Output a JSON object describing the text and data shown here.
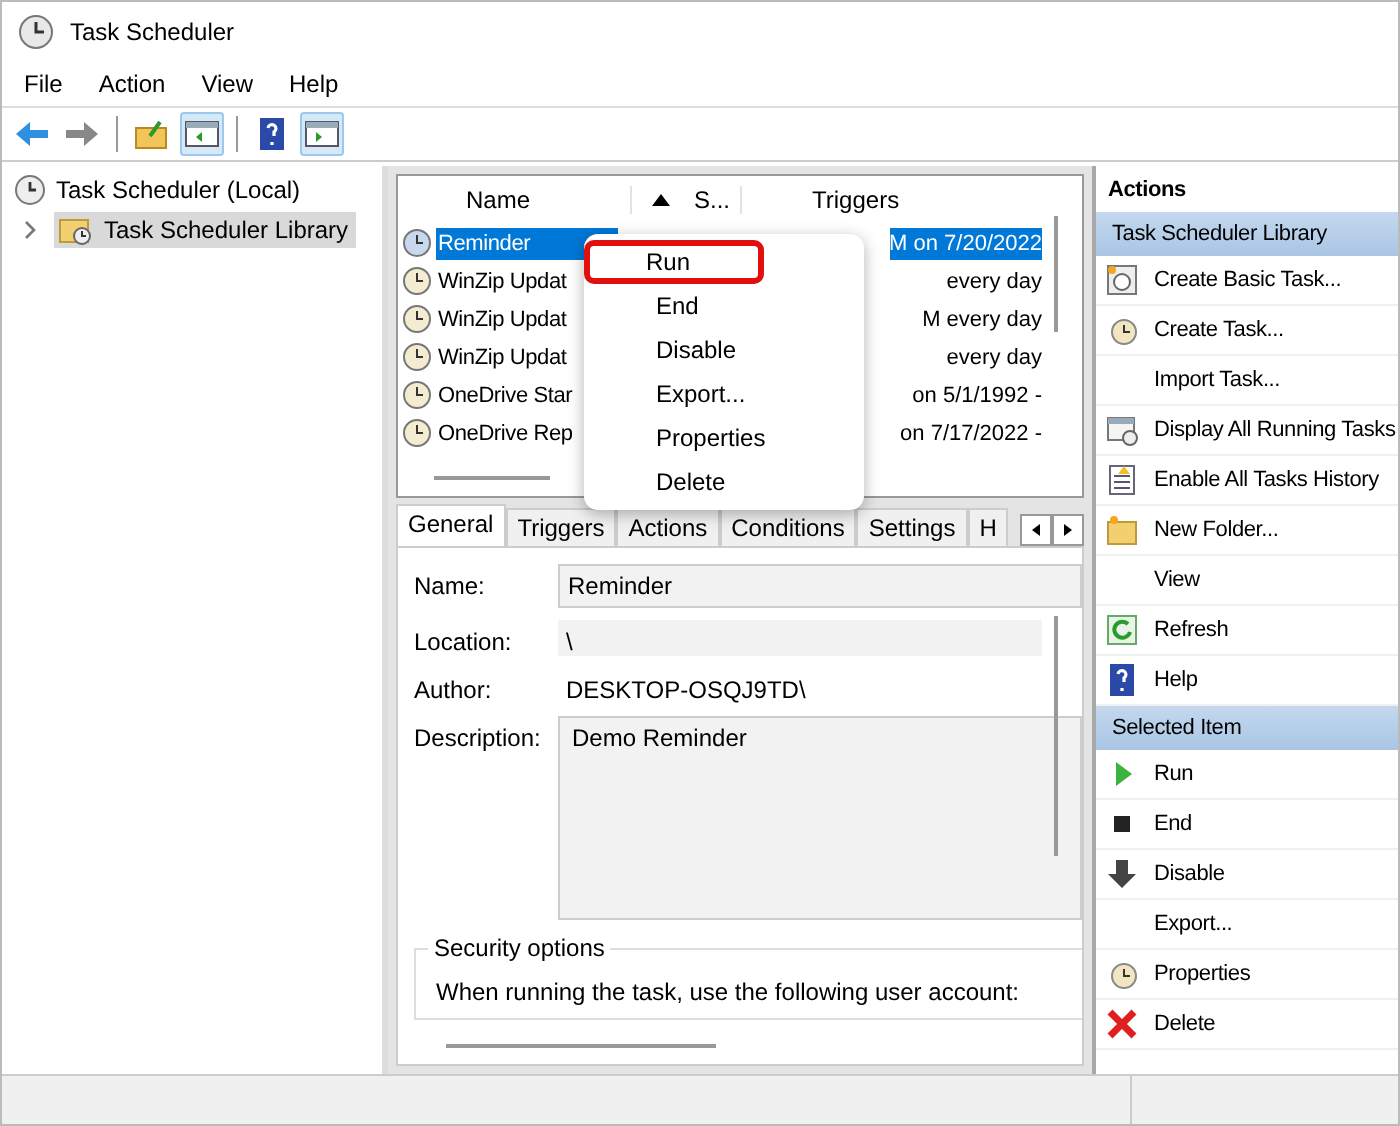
{
  "window": {
    "title": "Task Scheduler"
  },
  "menu": [
    "File",
    "Action",
    "View",
    "Help"
  ],
  "toolbar": [
    {
      "kind": "back",
      "pressed": false
    },
    {
      "kind": "forward",
      "pressed": false
    },
    {
      "kind": "up-folder",
      "pressed": false
    },
    {
      "kind": "pane-left",
      "pressed": true
    },
    {
      "kind": "help",
      "pressed": false
    },
    {
      "kind": "pane-right",
      "pressed": true
    }
  ],
  "tree": [
    {
      "label": "Task Scheduler (Local)",
      "selected": false,
      "children": [
        {
          "label": "Task Scheduler Library",
          "selected": true,
          "expanded": false
        }
      ]
    }
  ],
  "task_list": {
    "columns": [
      "Name",
      "S...",
      "Triggers"
    ],
    "rows": [
      {
        "name": "Reminder",
        "trigger": "M on 7/20/2022",
        "selected": true
      },
      {
        "name": "WinZip Updat",
        "trigger": "every day",
        "selected": false
      },
      {
        "name": "WinZip Updat",
        "trigger": "M every day",
        "selected": false
      },
      {
        "name": "WinZip Updat",
        "trigger": "every day",
        "selected": false
      },
      {
        "name": "OneDrive Star",
        "trigger": "on 5/1/1992 -",
        "selected": false
      },
      {
        "name": "OneDrive Rep",
        "trigger": "on 7/17/2022 -",
        "selected": false
      }
    ]
  },
  "context_menu": {
    "items": [
      {
        "label": "Run",
        "highlighted": true
      },
      {
        "label": "End",
        "highlighted": false
      },
      {
        "label": "Disable",
        "highlighted": false
      },
      {
        "label": "Export...",
        "highlighted": false
      },
      {
        "label": "Properties",
        "highlighted": false
      },
      {
        "label": "Delete",
        "highlighted": false
      }
    ]
  },
  "details": {
    "tabs": [
      {
        "label": "General",
        "selected": true
      },
      {
        "label": "Triggers",
        "selected": false
      },
      {
        "label": "Actions",
        "selected": false
      },
      {
        "label": "Conditions",
        "selected": false
      },
      {
        "label": "Settings",
        "selected": false
      },
      {
        "label": "H",
        "selected": false
      }
    ],
    "fields": [
      {
        "label": "Name:",
        "value": "Reminder",
        "kind": "box"
      },
      {
        "label": "Location:",
        "value": "\\",
        "kind": "plain"
      },
      {
        "label": "Author:",
        "value": "DESKTOP-OSQJ9TD\\",
        "kind": "plain"
      },
      {
        "label": "Description:",
        "value": "Demo Reminder",
        "kind": "area"
      }
    ],
    "security": {
      "title": "Security options",
      "text": "When running the task, use the following user account:"
    }
  },
  "actions": {
    "title": "Actions",
    "sections": [
      {
        "title": "Task Scheduler Library",
        "items": [
          {
            "label": "Create Basic Task...",
            "kind": "basic-task"
          },
          {
            "label": "Create Task...",
            "kind": "task"
          },
          {
            "label": "Import Task...",
            "kind": "plain"
          },
          {
            "label": "Display All Running Tasks",
            "kind": "running"
          },
          {
            "label": "Enable All Tasks History",
            "kind": "history"
          },
          {
            "label": "New Folder...",
            "kind": "folder"
          },
          {
            "label": "View",
            "kind": "plain"
          },
          {
            "label": "Refresh",
            "kind": "refresh"
          },
          {
            "label": "Help",
            "kind": "help"
          }
        ]
      },
      {
        "title": "Selected Item",
        "items": [
          {
            "label": "Run",
            "kind": "run"
          },
          {
            "label": "End",
            "kind": "end"
          },
          {
            "label": "Disable",
            "kind": "disable"
          },
          {
            "label": "Export...",
            "kind": "plain"
          },
          {
            "label": "Properties",
            "kind": "properties"
          },
          {
            "label": "Delete",
            "kind": "delete"
          }
        ]
      }
    ]
  }
}
